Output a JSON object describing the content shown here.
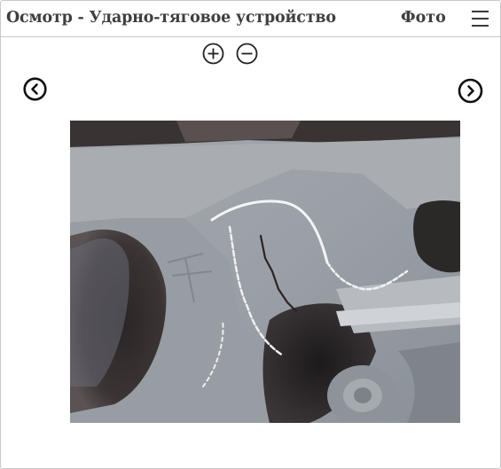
{
  "header": {
    "title": "Осмотр - Ударно-тяговое устройство",
    "photo_label": "Фото",
    "menu_icon": "hamburger-menu-icon"
  },
  "viewer": {
    "zoom_in_icon": "plus-circle-icon",
    "zoom_out_icon": "minus-circle-icon",
    "prev_icon": "chevron-left-circle-icon",
    "next_icon": "chevron-right-circle-icon",
    "photo_subject": "coupler-component-crack"
  },
  "colors": {
    "text": "#3f3f3f",
    "border": "#c8c8c8",
    "icon": "#222222"
  }
}
